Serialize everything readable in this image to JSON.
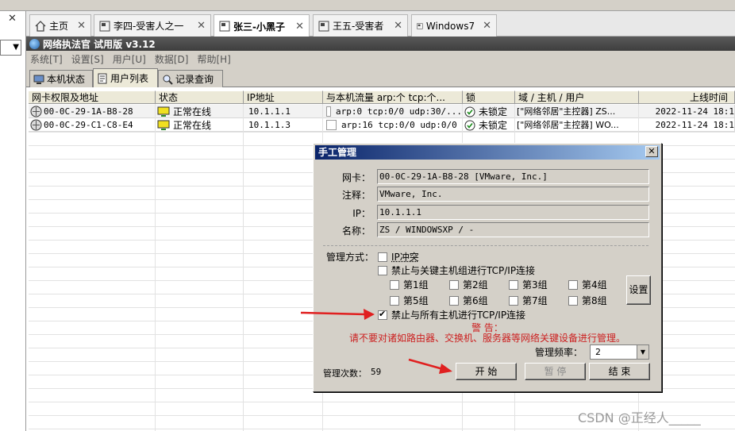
{
  "browser_tabs": [
    {
      "label": "主页"
    },
    {
      "label": "李四-受害人之一"
    },
    {
      "label": "张三-小黑子"
    },
    {
      "label": "王五-受害者"
    },
    {
      "label": "Windows7"
    }
  ],
  "app": {
    "title": "网络执法官 试用版 v3.12",
    "menu": [
      "系统[T]",
      "设置[S]",
      "用户[U]",
      "数据[D]",
      "帮助[H]"
    ],
    "subtabs": [
      "本机状态",
      "用户列表",
      "记录查询"
    ]
  },
  "grid": {
    "headers": [
      "网卡权限及地址",
      "状态",
      "IP地址",
      "与本机流量 arp:个 tcp:个...",
      "锁",
      "域 / 主机 / 用户",
      "上线时间"
    ],
    "rows": [
      {
        "mac": "00-0C-29-1A-B8-28",
        "status": "正常在线",
        "ip": "10.1.1.1",
        "traffic": "arp:0 tcp:0/0 udp:30/...",
        "lock": "未锁定",
        "host": "[\"网络邻居\"主控器] ZS...",
        "time": "2022-11-24 18:1"
      },
      {
        "mac": "00-0C-29-C1-C8-E4",
        "status": "正常在线",
        "ip": "10.1.1.3",
        "traffic": "arp:16 tcp:0/0 udp:0/0",
        "lock": "未锁定",
        "host": "[\"网络邻居\"主控器] WO...",
        "time": "2022-11-24 18:1"
      }
    ]
  },
  "dialog": {
    "title": "手工管理",
    "close": "✕",
    "fields": [
      {
        "label": "网卡：",
        "value": "00-0C-29-1A-B8-28 [VMware, Inc.]"
      },
      {
        "label": "注释：",
        "value": "VMware, Inc."
      },
      {
        "label": "IP：",
        "value": "10.1.1.1"
      },
      {
        "label": "名称：",
        "value": "ZS / WINDOWSXP / -"
      }
    ],
    "mgmt_label": "管理方式：",
    "opt_ip_conflict": "IP冲突",
    "opt_key_hosts": "禁止与关键主机组进行TCP/IP连接",
    "groups": [
      "第1组",
      "第2组",
      "第3组",
      "第4组",
      "第5组",
      "第6组",
      "第7组",
      "第8组"
    ],
    "settings_button": "设置",
    "opt_all_hosts": "禁止与所有主机进行TCP/IP连接",
    "warning_title": "警 告：",
    "warning_text": "请不要对诸如路由器、交换机、服务器等网络关键设备进行管理。",
    "freq_label": "管理频率：",
    "freq_value": "2",
    "count_label": "管理次数：",
    "count_value": "59",
    "btn_start": "开 始",
    "btn_pause": "暂 停",
    "btn_end": "结 束"
  },
  "watermark": "CSDN @正经人_____",
  "colors": {
    "titlebar": "#0a246a",
    "warning": "#cc2020",
    "arrow": "#e02020"
  }
}
